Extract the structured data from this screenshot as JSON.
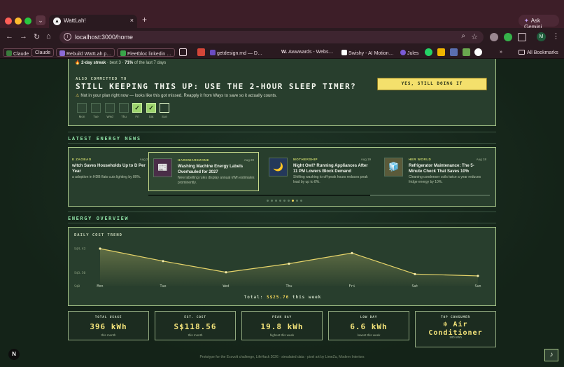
{
  "browser": {
    "tab_title": "WattLah!",
    "tab_favicon": "▲",
    "new_tab": "+",
    "gemini_label": "Ask Gemini",
    "url": "localhost:3000/home",
    "profile_initial": "M",
    "bookmarks": [
      {
        "label": "Claude",
        "color": "#3a7b3c"
      },
      {
        "label": "Claude",
        "color": "#c67b4b"
      },
      {
        "label": "Rebuild WattLah p…",
        "color": "#8c6bd6"
      },
      {
        "label": "Fleetbloc linkedin …",
        "color": "#3aa54a"
      },
      {
        "label": "getdesign.md — D…",
        "color": "#6b4cc2"
      },
      {
        "label": "Awwwards - Webs…",
        "color": "#ffffff"
      },
      {
        "label": "Swishy - AI Motion…",
        "color": "#ffffff"
      },
      {
        "label": "Jules",
        "color": "#7a5ad6"
      }
    ],
    "all_bookmarks": "All Bookmarks"
  },
  "commitment": {
    "streak_prefix": "🔥 2-day streak",
    "streak_rest": " · best 3 · ",
    "streak_rate": "71%",
    "streak_suffix": " of the last 7 days",
    "also_label": "ALSO COMMITTED TO",
    "title": "STILL KEEPING THIS UP: USE THE 2-HOUR SLEEP TIMER?",
    "button": "YES, STILL DOING IT",
    "warning_icon": "⚠",
    "warning": "Not in your plan right now — looks like this got missed. Reapply it from Ways to save so it actually counts.",
    "days": [
      {
        "label": "Mon",
        "state": "empty"
      },
      {
        "label": "Tue",
        "state": "empty"
      },
      {
        "label": "Wed",
        "state": "empty"
      },
      {
        "label": "Thu",
        "state": "empty"
      },
      {
        "label": "Fri",
        "state": "done"
      },
      {
        "label": "Sat",
        "state": "done"
      },
      {
        "label": "Sun",
        "state": "today"
      }
    ],
    "check_mark": "✓"
  },
  "news": {
    "section_title": "LATEST ENERGY NEWS",
    "cards": [
      {
        "source": "E ZAOBAO",
        "date": "Aug 22",
        "headline": "witch Saves Households Up to D Per Year",
        "desc": "a adoption in HDB flats cuts lighting by 80%.",
        "thumb": ""
      },
      {
        "source": "HARDWAREZONE",
        "date": "Aug 20",
        "headline": "Washing Machine Energy Labels Overhauled for 2027",
        "desc": "New labelling rules display annual kWh estimates prominently.",
        "thumb": "📰"
      },
      {
        "source": "MOTHERSHIP",
        "date": "Aug 19",
        "headline": "Night Owl? Running Appliances After 11 PM Lowers Block Demand",
        "desc": "Shifting washing to off-peak hours reduces peak load by up to 8%.",
        "thumb": "🌙"
      },
      {
        "source": "HER WORLD",
        "date": "Aug 18",
        "headline": "Refrigerator Maintenance: The 5-Minute Check That Saves 10%",
        "desc": "Cleaning condenser coils twice a year reduces fridge energy by 10%.",
        "thumb": "🧊"
      }
    ],
    "progress": 0.65,
    "pager_count": 9,
    "pager_active": 6
  },
  "overview": {
    "section_title": "ENERGY OVERVIEW",
    "chart_title": "DAILY COST TREND",
    "total_label": "Total: ",
    "total_value": "S$25.76",
    "total_suffix": " this week"
  },
  "chart_data": {
    "type": "area",
    "title": "DAILY COST TREND",
    "x": [
      "Mon",
      "Tue",
      "Wed",
      "Thu",
      "Fri",
      "Sat",
      "Sun"
    ],
    "series": [
      {
        "values": [
          4.43,
          3.95,
          3.52,
          3.85,
          4.26,
          3.45,
          3.38
        ]
      }
    ],
    "ytick_labels": [
      "S$4.43",
      "S$3.50",
      "S$0"
    ],
    "ytick_values": [
      4.43,
      3.5,
      0
    ],
    "ylim": [
      0,
      4.43
    ],
    "grid": false,
    "colors": {
      "line": "#e6d46a",
      "point": "#f4eaa8"
    }
  },
  "stats": [
    {
      "label": "TOTAL USAGE",
      "value": "396 kWh",
      "sub": "this month"
    },
    {
      "label": "EST. COST",
      "value": "S$118.56",
      "sub": "this month"
    },
    {
      "label": "PEAK DAY",
      "value": "19.8 kWh",
      "sub": "highest this week"
    },
    {
      "label": "LOW DAY",
      "value": "6.6 kWh",
      "sub": "lowest this week"
    },
    {
      "label": "TOP CONSUMER",
      "value": "❄ Air Conditioner",
      "sub": "180 kWh"
    }
  ],
  "footer": "Prototype for the Ecovolt challenge, LifeHack 2026 · simulated data · pixel art by LimeZu, Modern Interiors",
  "dev_badge": "N",
  "music_icon": "♪"
}
